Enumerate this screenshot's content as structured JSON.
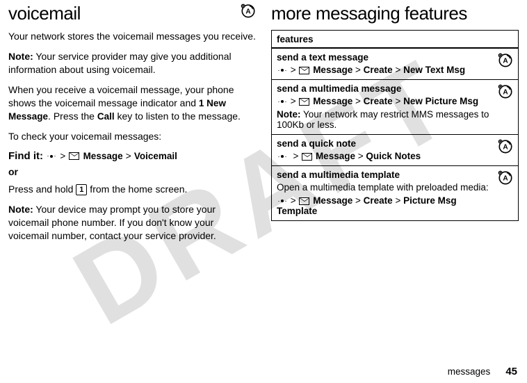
{
  "watermark": "DRAFT",
  "left": {
    "heading": "voicemail",
    "p1": "Your network stores the voicemail messages you receive.",
    "note1_label": "Note:",
    "note1_text": " Your service provider may give you additional information about using voicemail.",
    "p2a": "When you receive a voicemail message, your phone shows the voicemail message indicator and ",
    "p2b_bold": "1 New Message",
    "p2c": ". Press the ",
    "p2d_bold": "Call",
    "p2e": " key to listen to the message.",
    "p3": "To check your voicemail messages:",
    "find_label": "Find it:",
    "path1": {
      "msg": "Message",
      "voicemail": "Voicemail"
    },
    "or": "or",
    "p4a": "Press and hold ",
    "key1": "1",
    "p4b": " from the home screen.",
    "note2_label": "Note:",
    "note2_text": " Your device may prompt you to store your voicemail phone number. If you don't know your voicemail number, contact your service provider."
  },
  "right": {
    "heading": "more messaging features",
    "thead": "features",
    "rows": {
      "r1": {
        "title": "send a text message",
        "msg": "Message",
        "create": "Create",
        "target": "New Text Msg"
      },
      "r2": {
        "title": "send a multimedia message",
        "msg": "Message",
        "create": "Create",
        "target": "New Picture Msg",
        "note_label": "Note:",
        "note_text": " Your network may restrict MMS messages to 100Kb or less."
      },
      "r3": {
        "title": "send a quick note",
        "msg": "Message",
        "target": "Quick Notes"
      },
      "r4": {
        "title": "send a multimedia template",
        "desc": "Open a multimedia template with preloaded media:",
        "msg": "Message",
        "create": "Create",
        "target": "Picture Msg Template"
      }
    }
  },
  "footer": {
    "section": "messages",
    "page": "45"
  }
}
